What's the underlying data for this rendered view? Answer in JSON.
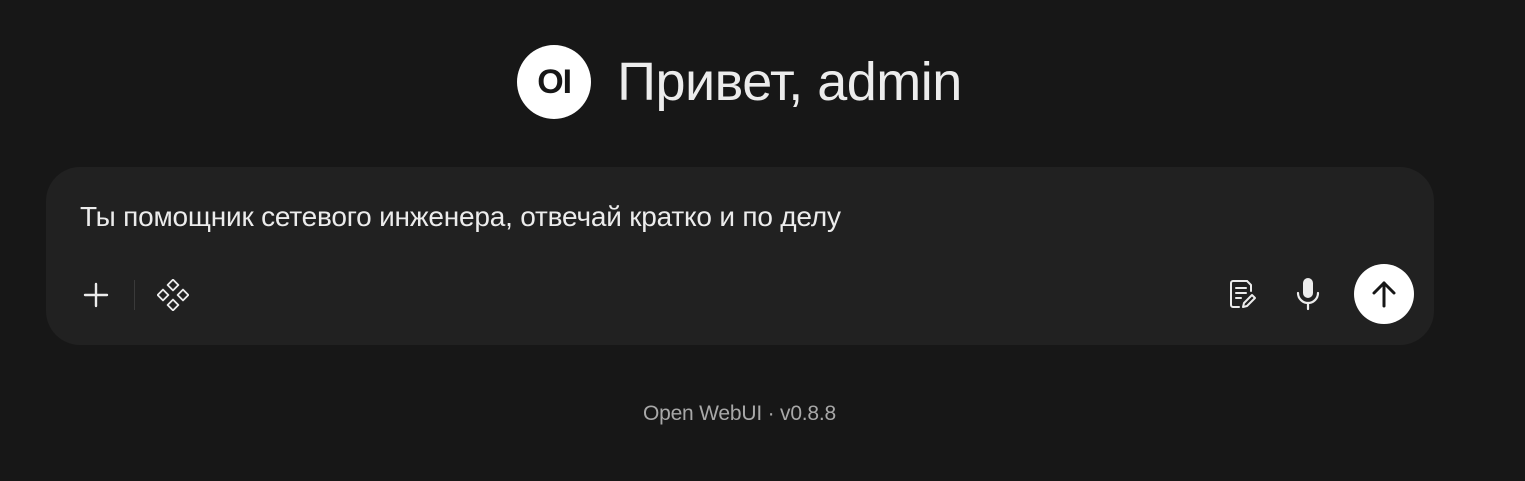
{
  "greeting": {
    "logo_text": "OI",
    "text": "Привет, admin"
  },
  "composer": {
    "input_value": "Ты помощник сетевого инженера, отвечай кратко и по делу",
    "left_icons": [
      "plus-icon",
      "integrations-icon"
    ],
    "right_icons": [
      "notes-icon",
      "microphone-icon",
      "arrow-up-icon"
    ]
  },
  "footer": {
    "text": "Open WebUI · v0.8.8"
  },
  "colors": {
    "background": "#171717",
    "composer_bg": "#212121",
    "send_button": "#ffffff",
    "text": "#ececec",
    "muted_text": "#a8a8a8"
  }
}
